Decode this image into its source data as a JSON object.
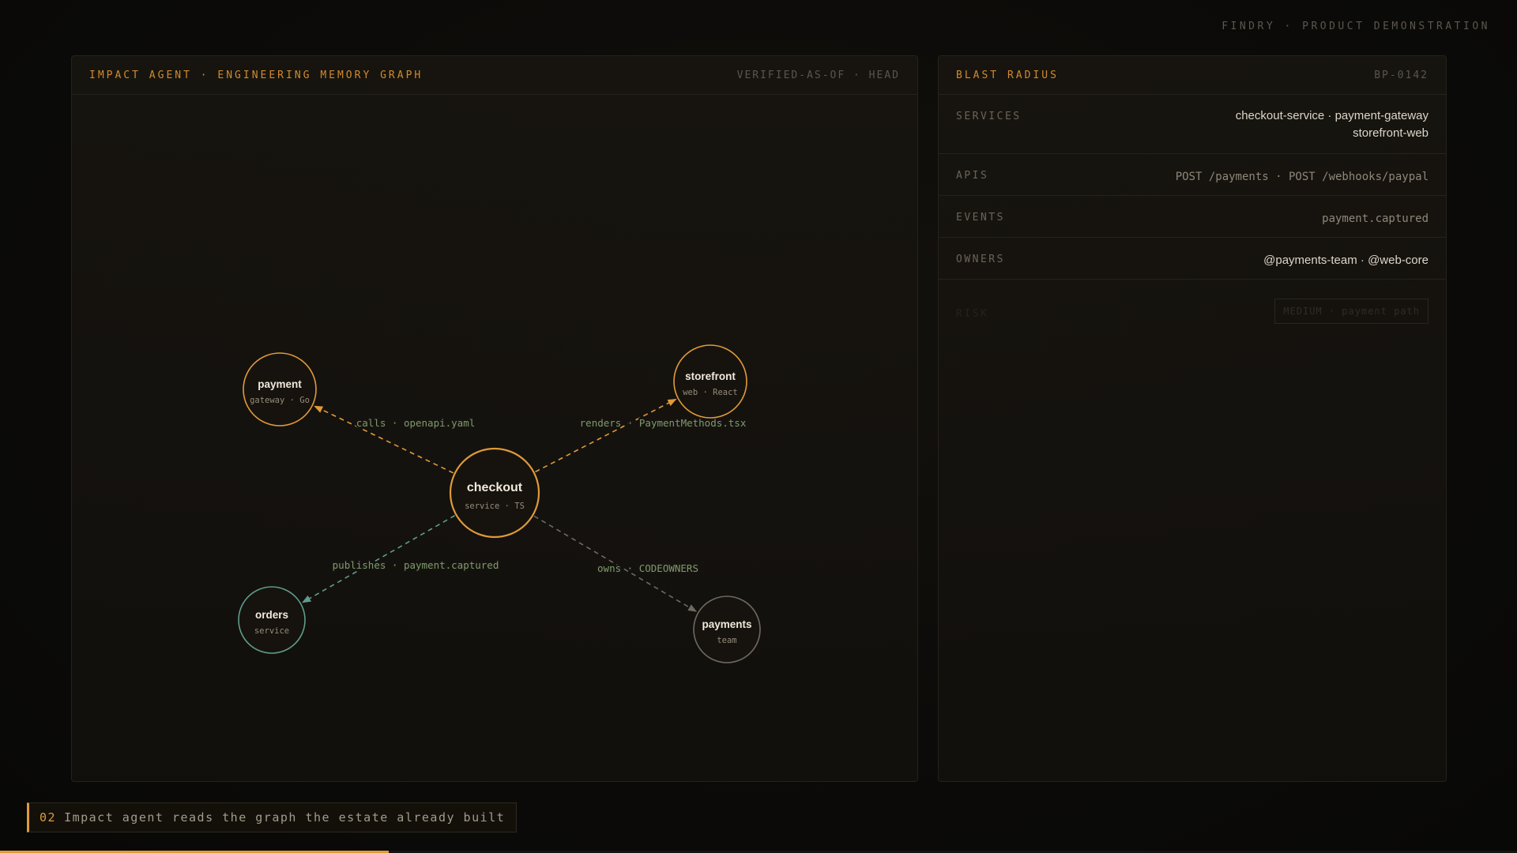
{
  "brand": "FINDRY · PRODUCT DEMONSTRATION",
  "graph_panel": {
    "title": "IMPACT AGENT · ENGINEERING MEMORY GRAPH",
    "meta": "VERIFIED-AS-OF · HEAD"
  },
  "graph": {
    "nodes": [
      {
        "id": "checkout",
        "name": "checkout",
        "sub": "service · TS",
        "kind": "primary"
      },
      {
        "id": "payment",
        "name": "payment",
        "sub": "gateway · Go",
        "kind": "amber"
      },
      {
        "id": "storefront",
        "name": "storefront",
        "sub": "web · React",
        "kind": "amber"
      },
      {
        "id": "orders",
        "name": "orders",
        "sub": "service",
        "kind": "teal"
      },
      {
        "id": "payments",
        "name": "payments",
        "sub": "team",
        "kind": "gray"
      }
    ],
    "edges": [
      {
        "from": "checkout",
        "to": "payment",
        "label": "calls · openapi.yaml",
        "kind": "amber"
      },
      {
        "from": "checkout",
        "to": "storefront",
        "label": "renders · PaymentMethods.tsx",
        "kind": "amber"
      },
      {
        "from": "checkout",
        "to": "orders",
        "label": "publishes · payment.captured",
        "kind": "teal"
      },
      {
        "from": "checkout",
        "to": "payments",
        "label": "owns · CODEOWNERS",
        "kind": "gray"
      }
    ]
  },
  "blast_panel": {
    "title": "BLAST RADIUS",
    "meta": "BP-0142",
    "rows": {
      "services": {
        "label": "SERVICES",
        "line1": "checkout-service · payment-gateway",
        "line2": "storefront-web"
      },
      "apis": {
        "label": "APIS",
        "value": "POST /payments · POST /webhooks/paypal"
      },
      "events": {
        "label": "EVENTS",
        "value": "payment.captured"
      },
      "owners": {
        "label": "OWNERS",
        "value": "@payments-team · @web-core"
      },
      "risk": {
        "label": "RISK",
        "value": "MEDIUM · payment path"
      }
    }
  },
  "caption": {
    "number": "02",
    "text": "Impact agent reads the graph the estate already built"
  },
  "progress": {
    "fraction": 0.256
  },
  "colors": {
    "amber": "#e09a3a",
    "teal": "#5f9c8c",
    "gray": "#6e6a60",
    "label": "#7f9a6c"
  }
}
